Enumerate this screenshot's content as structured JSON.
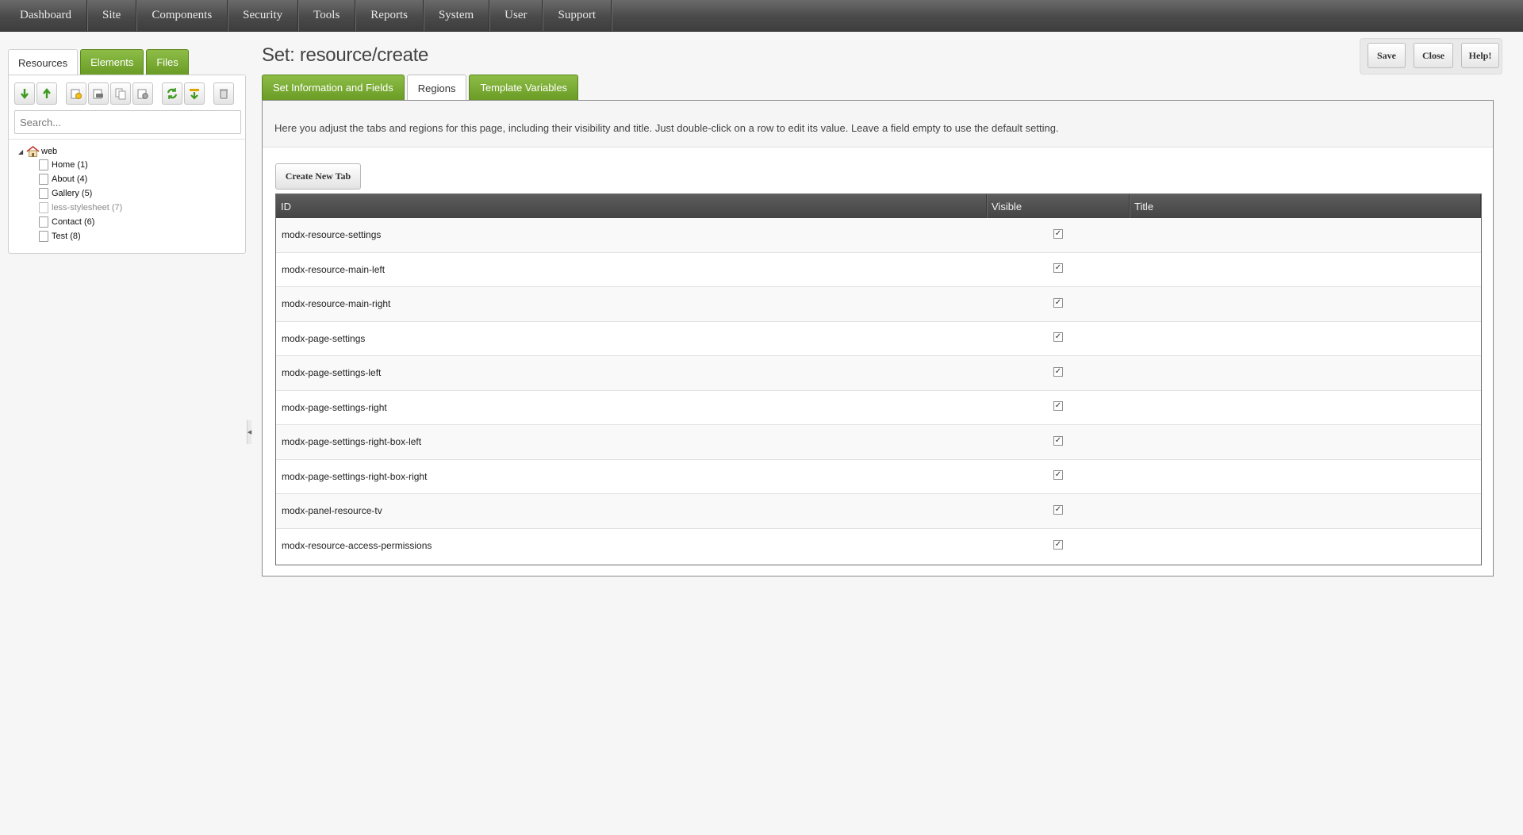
{
  "topnav": {
    "items": [
      "Dashboard",
      "Site",
      "Components",
      "Security",
      "Tools",
      "Reports",
      "System",
      "User",
      "Support"
    ]
  },
  "left_panel": {
    "tabs": [
      {
        "label": "Resources",
        "active": true
      },
      {
        "label": "Elements",
        "active": false
      },
      {
        "label": "Files",
        "active": false
      }
    ],
    "toolbar_icons": [
      "expand-all-icon",
      "collapse-all-icon",
      "new-folder-icon",
      "new-weblink-icon",
      "new-symlink-icon",
      "new-static-resource-icon",
      "refresh-icon",
      "sort-icon",
      "purge-icon"
    ],
    "search": {
      "placeholder": "Search...",
      "value": ""
    },
    "tree": {
      "root": "web",
      "nodes": [
        {
          "label": "Home",
          "id": "(1)",
          "muted": false
        },
        {
          "label": "About",
          "id": "(4)",
          "muted": false
        },
        {
          "label": "Gallery",
          "id": "(5)",
          "muted": false
        },
        {
          "label": "less-stylesheet",
          "id": "(7)",
          "muted": true
        },
        {
          "label": "Contact",
          "id": "(6)",
          "muted": false
        },
        {
          "label": "Test",
          "id": "(8)",
          "muted": false
        }
      ]
    }
  },
  "header": {
    "title": "Set: resource/create",
    "buttons": {
      "save": "Save",
      "close": "Close",
      "help": "Help!"
    }
  },
  "tabs": [
    {
      "label": "Set Information and Fields",
      "active": false
    },
    {
      "label": "Regions",
      "active": true
    },
    {
      "label": "Template Variables",
      "active": false
    }
  ],
  "regions": {
    "intro": "Here you adjust the tabs and regions for this page, including their visibility and title. Just double-click on a row to edit its value. Leave a field empty to use the default setting.",
    "create_button": "Create New Tab",
    "columns": [
      "ID",
      "Visible",
      "Title"
    ],
    "rows": [
      {
        "id": "modx-resource-settings",
        "visible": true,
        "title": ""
      },
      {
        "id": "modx-resource-main-left",
        "visible": true,
        "title": ""
      },
      {
        "id": "modx-resource-main-right",
        "visible": true,
        "title": ""
      },
      {
        "id": "modx-page-settings",
        "visible": true,
        "title": ""
      },
      {
        "id": "modx-page-settings-left",
        "visible": true,
        "title": ""
      },
      {
        "id": "modx-page-settings-right",
        "visible": true,
        "title": ""
      },
      {
        "id": "modx-page-settings-right-box-left",
        "visible": true,
        "title": ""
      },
      {
        "id": "modx-page-settings-right-box-right",
        "visible": true,
        "title": ""
      },
      {
        "id": "modx-panel-resource-tv",
        "visible": true,
        "title": ""
      },
      {
        "id": "modx-resource-access-permissions",
        "visible": true,
        "title": ""
      }
    ]
  },
  "colors": {
    "tab_green": "#7aab33",
    "nav_dark": "#4a4a4a",
    "grid_header": "#505050"
  }
}
